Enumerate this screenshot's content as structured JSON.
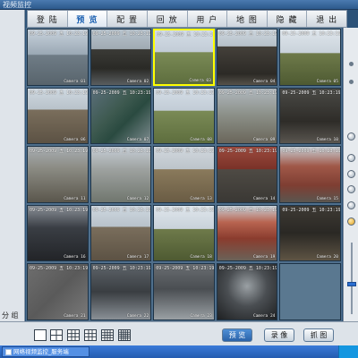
{
  "window": {
    "title": "视频监控"
  },
  "menu": {
    "items": [
      {
        "label": "登 陆",
        "active": false
      },
      {
        "label": "预 览",
        "active": true
      },
      {
        "label": "配 置",
        "active": false
      },
      {
        "label": "回 放",
        "active": false
      },
      {
        "label": "用 户",
        "active": false
      },
      {
        "label": "地 图",
        "active": false
      },
      {
        "label": "隐 藏",
        "active": false
      },
      {
        "label": "退 出",
        "active": false
      }
    ]
  },
  "left_panel": {
    "label": "分 组"
  },
  "grid": {
    "tiles": [
      {
        "stamp": "09-25-2009 五 10:23:19",
        "camera": "Camera 01",
        "scene": "workshop"
      },
      {
        "stamp": "09-25-2009 五 10:23:19",
        "camera": "Camera 02",
        "scene": "trucks"
      },
      {
        "stamp": "09-25-2009 五 10:23:19",
        "camera": "Camera 03",
        "scene": "yard-grass",
        "selected": true
      },
      {
        "stamp": "09-25-2009 五 10:23:19",
        "camera": "Camera 04",
        "scene": "coal-pile"
      },
      {
        "stamp": "09-25-2009 五 10:23:19",
        "camera": "Camera 05",
        "scene": "open-field"
      },
      {
        "stamp": "09-25-2009 五 10:23:19",
        "camera": "Camera 06",
        "scene": "muddy-road"
      },
      {
        "stamp": "09-25-2009 五 10:23:19",
        "camera": "Camera 07",
        "scene": "machine-room"
      },
      {
        "stamp": "09-25-2009 五 10:23:19",
        "camera": "Camera 08",
        "scene": "yard-grass"
      },
      {
        "stamp": "09-25-2009 五 10:23:19",
        "camera": "Camera 09",
        "scene": "foundation"
      },
      {
        "stamp": "09-25-2009 五 10:23:19",
        "camera": "Camera 10",
        "scene": "dark-room"
      },
      {
        "stamp": "09-25-2009 五 10:23:19",
        "camera": "Camera 11",
        "scene": "warehouse"
      },
      {
        "stamp": "09-25-2009 五 10:23:19",
        "camera": "Camera 12",
        "scene": "shed"
      },
      {
        "stamp": "09-25-2009 五 10:23:19",
        "camera": "Camera 13",
        "scene": "dirt-mound"
      },
      {
        "stamp": "09-25-2009 五 10:23:19",
        "camera": "Camera 14",
        "scene": "red-truck"
      },
      {
        "stamp": "09-25-2009 五 10:23:19",
        "camera": "Camera 15",
        "scene": "brick-building"
      },
      {
        "stamp": "09-25-2009 五 10:23:19",
        "camera": "Camera 16",
        "scene": "control-desk"
      },
      {
        "stamp": "09-25-2009 五 10:23:19",
        "camera": "Camera 17",
        "scene": "muddy-road"
      },
      {
        "stamp": "09-25-2009 五 10:23:19",
        "camera": "Camera 18",
        "scene": "open-field"
      },
      {
        "stamp": "09-25-2009 五 10:23:19",
        "camera": "Camera 19",
        "scene": "red-roof"
      },
      {
        "stamp": "09-25-2009 五 10:23:19",
        "camera": "Camera 20",
        "scene": "night-yard"
      },
      {
        "stamp": "09-25-2009 五 10:23:19",
        "camera": "Camera 21",
        "scene": "gray-static"
      },
      {
        "stamp": "09-25-2009 五 10:23:19",
        "camera": "Camera 22",
        "scene": "conveyor"
      },
      {
        "stamp": "09-25-2009 五 10:23:19",
        "camera": "Camera 23",
        "scene": "crusher"
      },
      {
        "stamp": "09-25-2009 五 10:23:19",
        "camera": "Camera 24",
        "scene": "tunnel"
      },
      {
        "empty": true
      }
    ]
  },
  "layout_buttons": [
    {
      "name": "layout-1x1",
      "rows": 1
    },
    {
      "name": "layout-2x2",
      "rows": 2
    },
    {
      "name": "layout-3x3",
      "rows": 3
    },
    {
      "name": "layout-1plus5",
      "rows": 3
    },
    {
      "name": "layout-4x4",
      "rows": 4
    },
    {
      "name": "layout-5x5",
      "rows": 5
    }
  ],
  "actions": {
    "preview_label": "预 览",
    "record_label": "录 像",
    "capture_label": "抓 图"
  },
  "taskbar": {
    "task_label": "网络视频监控_服务端"
  },
  "colors": {
    "accent": "#2a62a8",
    "selected_border": "#ffff00",
    "menu_active": "#1a5fb0"
  }
}
